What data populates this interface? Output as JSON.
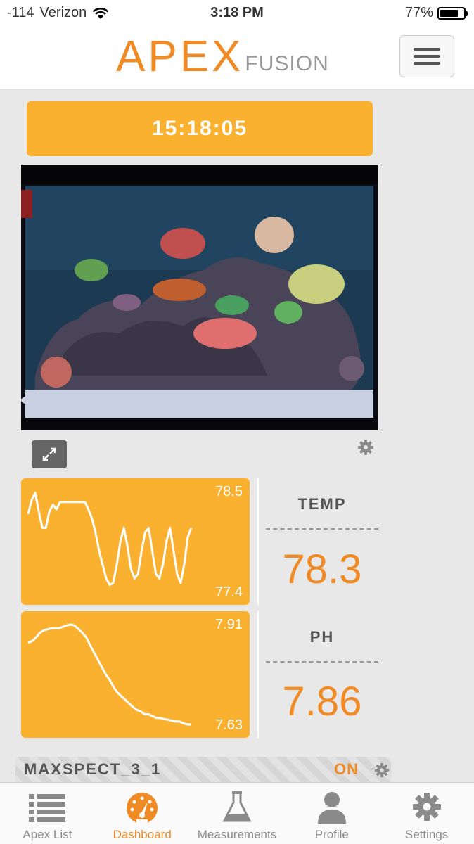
{
  "status_bar": {
    "signal": "-114",
    "carrier": "Verizon",
    "time": "3:18 PM",
    "battery": "77%",
    "battery_level": 0.77
  },
  "header": {
    "logo_main": "APEX",
    "logo_sub": "FUSION",
    "menu_icon": "hamburger-menu-icon"
  },
  "clock": {
    "time": "15:18:05"
  },
  "camera": {
    "expand_icon": "expand-arrows-icon",
    "settings_icon": "gear-icon"
  },
  "probes": [
    {
      "name": "TEMP",
      "value": "78.3",
      "graph_max": "78.5",
      "graph_min": "77.4",
      "history": [
        78.25,
        78.4,
        78.48,
        78.28,
        78.1,
        78.1,
        78.28,
        78.35,
        78.3,
        78.38,
        78.38,
        78.38,
        78.38,
        78.38,
        78.38,
        78.38,
        78.38,
        78.3,
        78.2,
        78.05,
        77.85,
        77.7,
        77.55,
        77.48,
        77.5,
        77.7,
        77.95,
        78.1,
        77.9,
        77.65,
        77.55,
        77.6,
        77.85,
        78.05,
        78.1,
        77.85,
        77.6,
        77.55,
        77.7,
        77.95,
        78.1,
        77.85,
        77.6,
        77.5,
        77.7,
        78.0,
        78.1
      ],
      "color": "#fbb130"
    },
    {
      "name": "PH",
      "value": "7.86",
      "graph_max": "7.91",
      "graph_min": "7.63",
      "history": [
        7.858,
        7.862,
        7.872,
        7.885,
        7.892,
        7.895,
        7.898,
        7.898,
        7.898,
        7.902,
        7.906,
        7.908,
        7.905,
        7.895,
        7.885,
        7.872,
        7.85,
        7.83,
        7.81,
        7.79,
        7.77,
        7.755,
        7.735,
        7.72,
        7.71,
        7.7,
        7.69,
        7.68,
        7.672,
        7.668,
        7.66,
        7.66,
        7.655,
        7.65,
        7.65,
        7.647,
        7.645,
        7.642,
        7.64,
        7.64,
        7.635,
        7.632,
        7.632
      ],
      "color": "#fbb130"
    }
  ],
  "outlet": {
    "name": "MAXSPECT_3_1",
    "state": "ON"
  },
  "tabs": [
    {
      "label": "Apex List",
      "icon": "list-icon",
      "active": false
    },
    {
      "label": "Dashboard",
      "icon": "dashboard-gauge-icon",
      "active": true
    },
    {
      "label": "Measurements",
      "icon": "flask-icon",
      "active": false
    },
    {
      "label": "Profile",
      "icon": "person-icon",
      "active": false
    },
    {
      "label": "Settings",
      "icon": "gear-icon",
      "active": false
    }
  ],
  "colors": {
    "accent": "#f08a24",
    "widget": "#fbb130",
    "tab_inactive": "#8a8a8a"
  }
}
